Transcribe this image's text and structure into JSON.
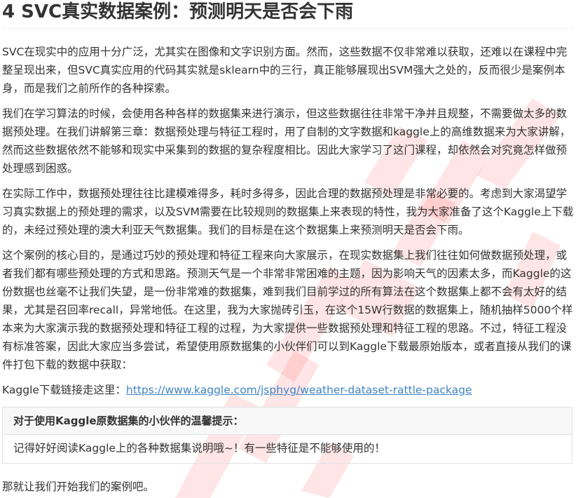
{
  "heading": "4 SVC真实数据案例：预测明天是否会下雨",
  "paragraphs": [
    "SVC在现实中的应用十分广泛，尤其实在图像和文字识别方面。然而，这些数据不仅非常难以获取，还难以在课程中完整呈现出来，但SVC真实应用的代码其实就是sklearn中的三行，真正能够展现出SVM强大之处的，反而很少是案例本身，而是我们之前所作的各种探索。",
    "我们在学习算法的时候，会使用各种各样的数据集来进行演示，但这些数据往往非常干净并且规整，不需要做太多的数据预处理。在我们讲解第三章：数据预处理与特征工程时，用了自制的文字数据和kaggle上的高维数据来为大家讲解，然而这些数据依然不能够和现实中采集到的数据的复杂程度相比。因此大家学习了这门课程，却依然会对究竟怎样做预处理感到困惑。",
    "在实际工作中，数据预处理往往比建模难得多，耗时多得多，因此合理的数据预处理是非常必要的。考虑到大家渴望学习真实数据上的预处理的需求，以及SVM需要在比较规则的数据集上来表现的特性，我为大家准备了这个Kaggle上下载的，未经过预处理的澳大利亚天气数据集。我们的目标是在这个数据集上来预测明天是否会下雨。",
    "这个案例的核心目的，是通过巧妙的预处理和特征工程来向大家展示，在现实数据集上我们往往如何做数据预处理，或者我们都有哪些预处理的方式和思路。预测天气是一个非常非常困难的主题，因为影响天气的因素太多，而Kaggle的这份数据也丝毫不让我们失望，是一份非常难的数据集，难到我们目前学过的所有算法在这个数据集上都不会有太好的结果，尤其是召回率recall，异常地低。在这里，我为大家抛砖引玉，在这个15W行数据的数据集上，随机抽样5000个样本来为大家演示我的数据预处理和特征工程的过程，为大家提供一些数据预处理和特征工程的思路。不过，特征工程没有标准答案，因此大家应当多尝试，希望使用原数据集的小伙伴们可以到Kaggle下载最原始版本，或者直接从我们的课件打包下载的数据中获取："
  ],
  "download": {
    "label": "Kaggle下载链接走这里：",
    "url": "https://www.kaggle.com/jsphyg/weather-dataset-rattle-package"
  },
  "tip": {
    "title": "对于使用Kaggle原数据集的小伙伴的温馨提示：",
    "body": "记得好好阅读Kaggle上的各种数据集说明哦~！有一些特征是不能够使用的！"
  },
  "closing": "那就让我们开始我们的案例吧。",
  "colors": {
    "text": "#333333",
    "link": "#4183c4",
    "watermark": "#ff3030"
  }
}
